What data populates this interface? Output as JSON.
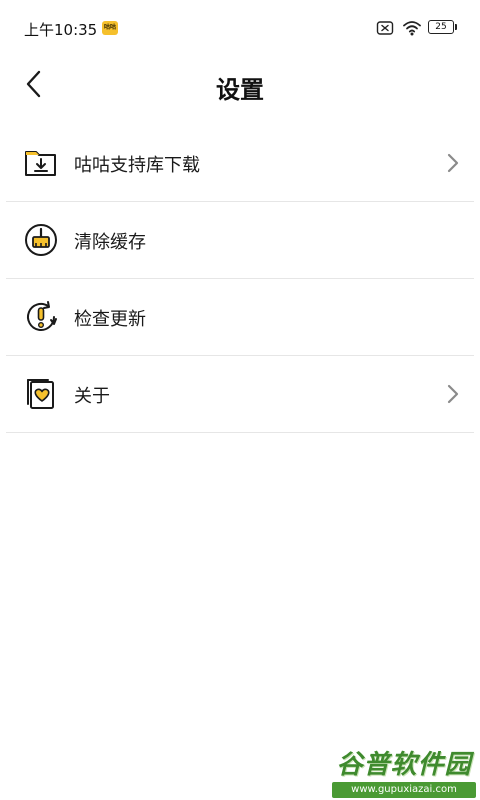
{
  "status_bar": {
    "time": "上午10:35",
    "app_badge": "咕咕",
    "battery": "25",
    "icons": [
      "notification-x-icon",
      "wifi-icon",
      "battery-icon"
    ]
  },
  "header": {
    "title": "设置",
    "back_icon": "chevron-left-icon"
  },
  "settings": {
    "items": [
      {
        "label": "咕咕支持库下载",
        "icon": "download-folder-icon",
        "has_chevron": true
      },
      {
        "label": "清除缓存",
        "icon": "broom-icon",
        "has_chevron": false
      },
      {
        "label": "检查更新",
        "icon": "update-alert-icon",
        "has_chevron": false
      },
      {
        "label": "关于",
        "icon": "heart-card-icon",
        "has_chevron": true
      }
    ]
  },
  "watermark": {
    "title": "谷普软件园",
    "url": "www.gupuxiazai.com"
  },
  "colors": {
    "accent": "#f5c02c",
    "divider": "#e6e6e6",
    "chevron": "#8a8a8a",
    "watermark_green": "#4a9a34"
  }
}
